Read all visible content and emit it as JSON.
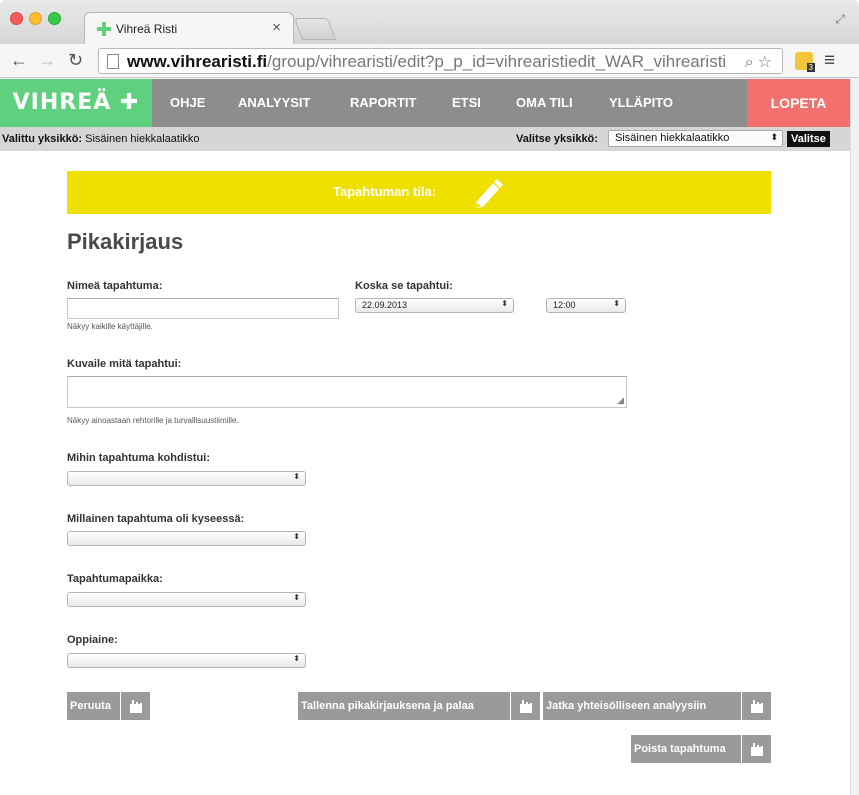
{
  "browser": {
    "tab_title": "Vihreä Risti",
    "url_host": "www.vihrearisti.fi",
    "url_path": "/group/vihrearisti/edit?p_p_id=vihrearistiedit_WAR_vihrearisti..."
  },
  "nav": {
    "logo": "VIHREÄ ✚ RISTI",
    "items": [
      "OHJE",
      "ANALYYSIT",
      "RAPORTIT",
      "ETSI",
      "OMA TILI",
      "YLLÄPITO"
    ],
    "logout": "LOPETA"
  },
  "unitbar": {
    "current_label": "Valittu yksikkö:",
    "current_value": "Sisäinen hiekkalaatikko",
    "select_label": "Valitse yksikkö:",
    "select_value": "Sisäinen hiekkalaatikko",
    "select_button": "Valitse"
  },
  "status": {
    "label": "Tapahtuman tila:"
  },
  "page": {
    "title": "Pikakirjaus"
  },
  "form": {
    "name_label": "Nimeä tapahtuma:",
    "name_value": "",
    "name_hint": "Näkyy kaikille käyttäjille.",
    "when_label": "Koska se tapahtui:",
    "date_value": "22.09.2013",
    "time_value": "12:00",
    "desc_label": "Kuvaile mitä tapahtui:",
    "desc_value": "",
    "desc_hint": "Näkyy ainoastaan rehtorille ja turvallisuustiimille.",
    "target_label": "Mihin tapahtuma kohdistui:",
    "type_label": "Millainen tapahtuma oli kyseessä:",
    "place_label": "Tapahtumapaikka:",
    "subject_label": "Oppiaine:"
  },
  "buttons": {
    "cancel": "Peruuta",
    "save_quick": "Tallenna pikakirjauksena ja palaa",
    "continue_analysis": "Jatka yhteisölliseen analyysiin",
    "delete": "Poista tapahtuma"
  },
  "icons": {
    "button_icon": "hand-pointer-icon",
    "status_icon": "pencil-icon"
  },
  "colors": {
    "logo_green": "#5fd07e",
    "nav_gray": "#8d8d8d",
    "logout_red": "#f2716e",
    "banner_yellow": "#f0e000",
    "button_gray": "#9a9a9a"
  }
}
